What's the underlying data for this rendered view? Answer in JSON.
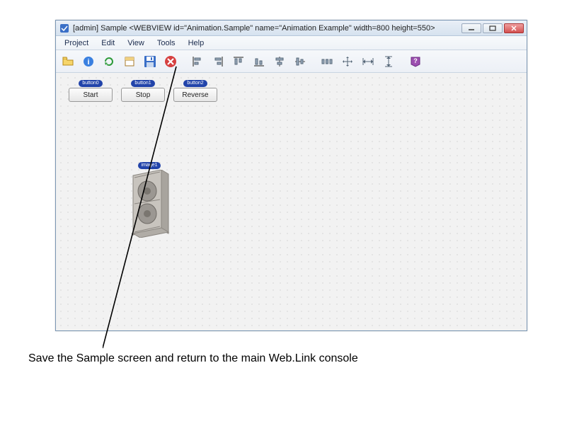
{
  "window": {
    "title": "[admin] Sample    <WEBVIEW id=\"Animation.Sample\" name=\"Animation Example\" width=800 height=550>"
  },
  "menu": {
    "items": [
      "Project",
      "Edit",
      "View",
      "Tools",
      "Help"
    ]
  },
  "buttons": {
    "b0": {
      "tag": "button0",
      "label": "Start"
    },
    "b1": {
      "tag": "button1",
      "label": "Stop"
    },
    "b2": {
      "tag": "button2",
      "label": "Reverse"
    }
  },
  "image": {
    "tag": "image1"
  },
  "caption": "Save the Sample screen and return to the main Web.Link console"
}
